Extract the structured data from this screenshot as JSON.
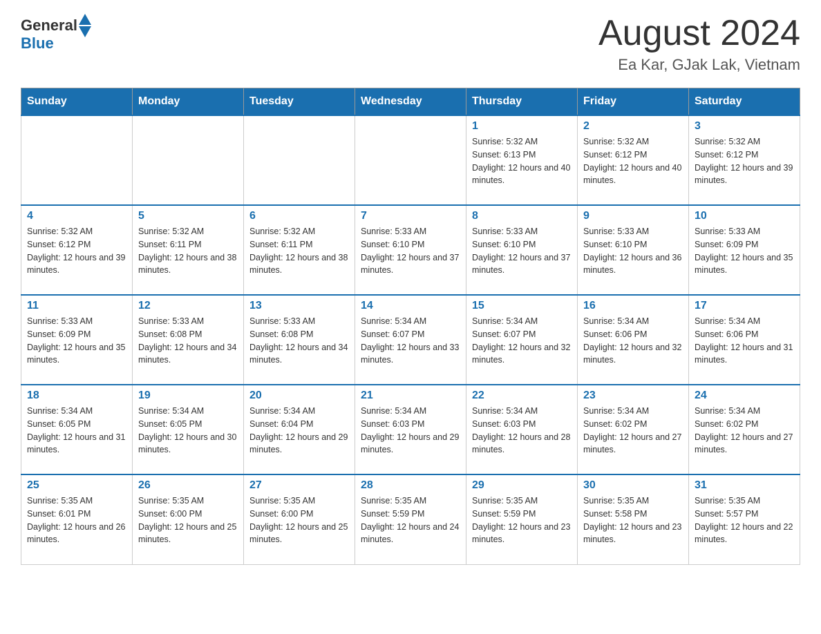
{
  "header": {
    "logo_general": "General",
    "logo_blue": "Blue",
    "title": "August 2024",
    "subtitle": "Ea Kar, GJak Lak, Vietnam"
  },
  "days_of_week": [
    "Sunday",
    "Monday",
    "Tuesday",
    "Wednesday",
    "Thursday",
    "Friday",
    "Saturday"
  ],
  "weeks": [
    [
      {
        "day": "",
        "sunrise": "",
        "sunset": "",
        "daylight": ""
      },
      {
        "day": "",
        "sunrise": "",
        "sunset": "",
        "daylight": ""
      },
      {
        "day": "",
        "sunrise": "",
        "sunset": "",
        "daylight": ""
      },
      {
        "day": "",
        "sunrise": "",
        "sunset": "",
        "daylight": ""
      },
      {
        "day": "1",
        "sunrise": "Sunrise: 5:32 AM",
        "sunset": "Sunset: 6:13 PM",
        "daylight": "Daylight: 12 hours and 40 minutes."
      },
      {
        "day": "2",
        "sunrise": "Sunrise: 5:32 AM",
        "sunset": "Sunset: 6:12 PM",
        "daylight": "Daylight: 12 hours and 40 minutes."
      },
      {
        "day": "3",
        "sunrise": "Sunrise: 5:32 AM",
        "sunset": "Sunset: 6:12 PM",
        "daylight": "Daylight: 12 hours and 39 minutes."
      }
    ],
    [
      {
        "day": "4",
        "sunrise": "Sunrise: 5:32 AM",
        "sunset": "Sunset: 6:12 PM",
        "daylight": "Daylight: 12 hours and 39 minutes."
      },
      {
        "day": "5",
        "sunrise": "Sunrise: 5:32 AM",
        "sunset": "Sunset: 6:11 PM",
        "daylight": "Daylight: 12 hours and 38 minutes."
      },
      {
        "day": "6",
        "sunrise": "Sunrise: 5:32 AM",
        "sunset": "Sunset: 6:11 PM",
        "daylight": "Daylight: 12 hours and 38 minutes."
      },
      {
        "day": "7",
        "sunrise": "Sunrise: 5:33 AM",
        "sunset": "Sunset: 6:10 PM",
        "daylight": "Daylight: 12 hours and 37 minutes."
      },
      {
        "day": "8",
        "sunrise": "Sunrise: 5:33 AM",
        "sunset": "Sunset: 6:10 PM",
        "daylight": "Daylight: 12 hours and 37 minutes."
      },
      {
        "day": "9",
        "sunrise": "Sunrise: 5:33 AM",
        "sunset": "Sunset: 6:10 PM",
        "daylight": "Daylight: 12 hours and 36 minutes."
      },
      {
        "day": "10",
        "sunrise": "Sunrise: 5:33 AM",
        "sunset": "Sunset: 6:09 PM",
        "daylight": "Daylight: 12 hours and 35 minutes."
      }
    ],
    [
      {
        "day": "11",
        "sunrise": "Sunrise: 5:33 AM",
        "sunset": "Sunset: 6:09 PM",
        "daylight": "Daylight: 12 hours and 35 minutes."
      },
      {
        "day": "12",
        "sunrise": "Sunrise: 5:33 AM",
        "sunset": "Sunset: 6:08 PM",
        "daylight": "Daylight: 12 hours and 34 minutes."
      },
      {
        "day": "13",
        "sunrise": "Sunrise: 5:33 AM",
        "sunset": "Sunset: 6:08 PM",
        "daylight": "Daylight: 12 hours and 34 minutes."
      },
      {
        "day": "14",
        "sunrise": "Sunrise: 5:34 AM",
        "sunset": "Sunset: 6:07 PM",
        "daylight": "Daylight: 12 hours and 33 minutes."
      },
      {
        "day": "15",
        "sunrise": "Sunrise: 5:34 AM",
        "sunset": "Sunset: 6:07 PM",
        "daylight": "Daylight: 12 hours and 32 minutes."
      },
      {
        "day": "16",
        "sunrise": "Sunrise: 5:34 AM",
        "sunset": "Sunset: 6:06 PM",
        "daylight": "Daylight: 12 hours and 32 minutes."
      },
      {
        "day": "17",
        "sunrise": "Sunrise: 5:34 AM",
        "sunset": "Sunset: 6:06 PM",
        "daylight": "Daylight: 12 hours and 31 minutes."
      }
    ],
    [
      {
        "day": "18",
        "sunrise": "Sunrise: 5:34 AM",
        "sunset": "Sunset: 6:05 PM",
        "daylight": "Daylight: 12 hours and 31 minutes."
      },
      {
        "day": "19",
        "sunrise": "Sunrise: 5:34 AM",
        "sunset": "Sunset: 6:05 PM",
        "daylight": "Daylight: 12 hours and 30 minutes."
      },
      {
        "day": "20",
        "sunrise": "Sunrise: 5:34 AM",
        "sunset": "Sunset: 6:04 PM",
        "daylight": "Daylight: 12 hours and 29 minutes."
      },
      {
        "day": "21",
        "sunrise": "Sunrise: 5:34 AM",
        "sunset": "Sunset: 6:03 PM",
        "daylight": "Daylight: 12 hours and 29 minutes."
      },
      {
        "day": "22",
        "sunrise": "Sunrise: 5:34 AM",
        "sunset": "Sunset: 6:03 PM",
        "daylight": "Daylight: 12 hours and 28 minutes."
      },
      {
        "day": "23",
        "sunrise": "Sunrise: 5:34 AM",
        "sunset": "Sunset: 6:02 PM",
        "daylight": "Daylight: 12 hours and 27 minutes."
      },
      {
        "day": "24",
        "sunrise": "Sunrise: 5:34 AM",
        "sunset": "Sunset: 6:02 PM",
        "daylight": "Daylight: 12 hours and 27 minutes."
      }
    ],
    [
      {
        "day": "25",
        "sunrise": "Sunrise: 5:35 AM",
        "sunset": "Sunset: 6:01 PM",
        "daylight": "Daylight: 12 hours and 26 minutes."
      },
      {
        "day": "26",
        "sunrise": "Sunrise: 5:35 AM",
        "sunset": "Sunset: 6:00 PM",
        "daylight": "Daylight: 12 hours and 25 minutes."
      },
      {
        "day": "27",
        "sunrise": "Sunrise: 5:35 AM",
        "sunset": "Sunset: 6:00 PM",
        "daylight": "Daylight: 12 hours and 25 minutes."
      },
      {
        "day": "28",
        "sunrise": "Sunrise: 5:35 AM",
        "sunset": "Sunset: 5:59 PM",
        "daylight": "Daylight: 12 hours and 24 minutes."
      },
      {
        "day": "29",
        "sunrise": "Sunrise: 5:35 AM",
        "sunset": "Sunset: 5:59 PM",
        "daylight": "Daylight: 12 hours and 23 minutes."
      },
      {
        "day": "30",
        "sunrise": "Sunrise: 5:35 AM",
        "sunset": "Sunset: 5:58 PM",
        "daylight": "Daylight: 12 hours and 23 minutes."
      },
      {
        "day": "31",
        "sunrise": "Sunrise: 5:35 AM",
        "sunset": "Sunset: 5:57 PM",
        "daylight": "Daylight: 12 hours and 22 minutes."
      }
    ]
  ]
}
